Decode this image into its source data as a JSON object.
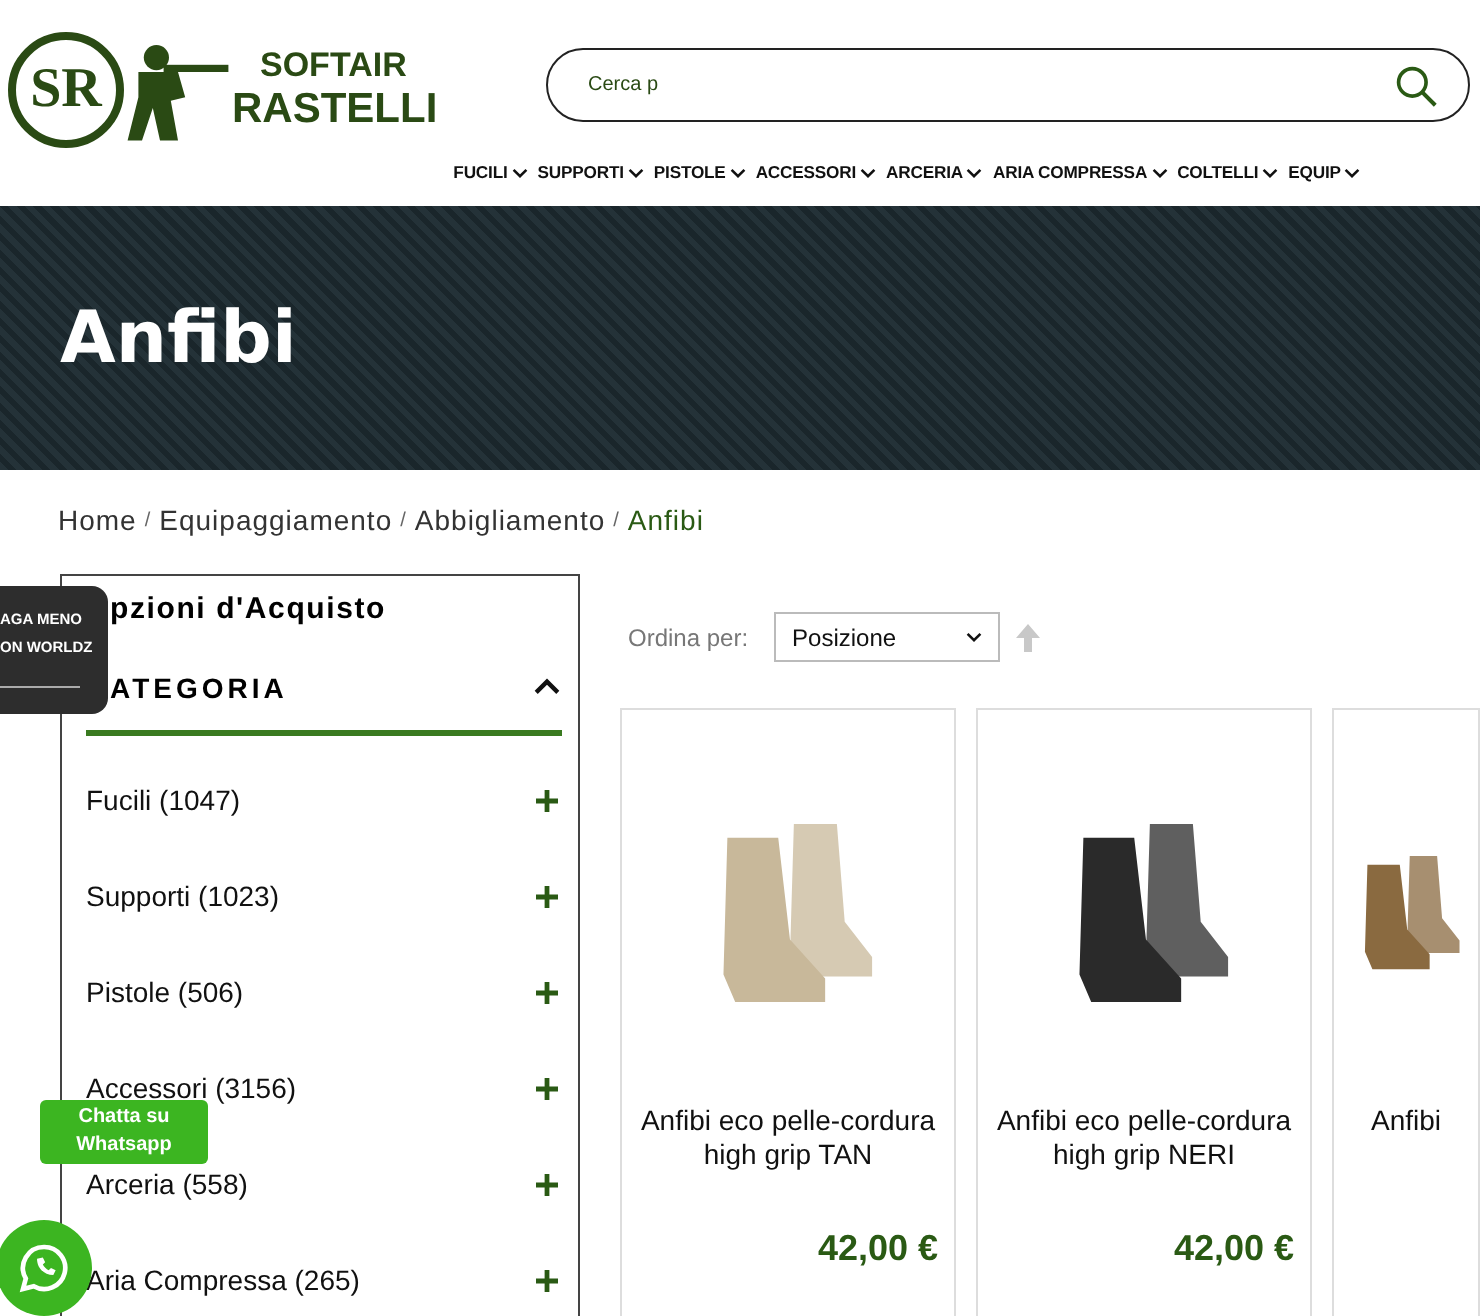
{
  "header": {
    "logo": {
      "monogram": "SR",
      "line1": "SOFTAIR",
      "line2": "RASTELLI"
    },
    "search": {
      "placeholder": "Cerca p"
    },
    "nav": [
      "FUCILI",
      "SUPPORTI",
      "PISTOLE",
      "ACCESSORI",
      "ARCERIA",
      "ARIA COMPRESSA",
      "COLTELLI",
      "EQUIP"
    ]
  },
  "banner": {
    "title": "Anfibi"
  },
  "breadcrumb": {
    "separator": "/",
    "items": [
      "Home",
      "Equipaggiamento",
      "Abbigliamento",
      "Anfibi"
    ]
  },
  "popup": {
    "lines": [
      "AGA MENO",
      "ON WORLDZ"
    ]
  },
  "sidebar": {
    "title": "pzioni d'Acquisto",
    "section": {
      "title": "ATEGORIA",
      "expanded": true
    },
    "categories": [
      {
        "name": "Fucili",
        "count": "(1047)"
      },
      {
        "name": "Supporti",
        "count": "(1023)"
      },
      {
        "name": "Pistole",
        "count": "(506)"
      },
      {
        "name": "Accessori",
        "count": "(3156)"
      },
      {
        "name": "Arceria",
        "count": "(558)"
      },
      {
        "name": "Aria Compressa",
        "count": "(265)"
      }
    ]
  },
  "sort": {
    "label": "Ordina per:",
    "value": "Posizione"
  },
  "products": [
    {
      "color": "#c8b89a",
      "title": "Anfibi eco pelle-cordura high grip TAN",
      "price": "42,00 €"
    },
    {
      "color": "#2a2a2a",
      "title": "Anfibi eco pelle-cordura high grip NERI",
      "price": "42,00 €"
    },
    {
      "color": "#8a6a40",
      "title": "Anfibi"
    }
  ],
  "chat": {
    "label": "Chatta su Whatsapp"
  }
}
